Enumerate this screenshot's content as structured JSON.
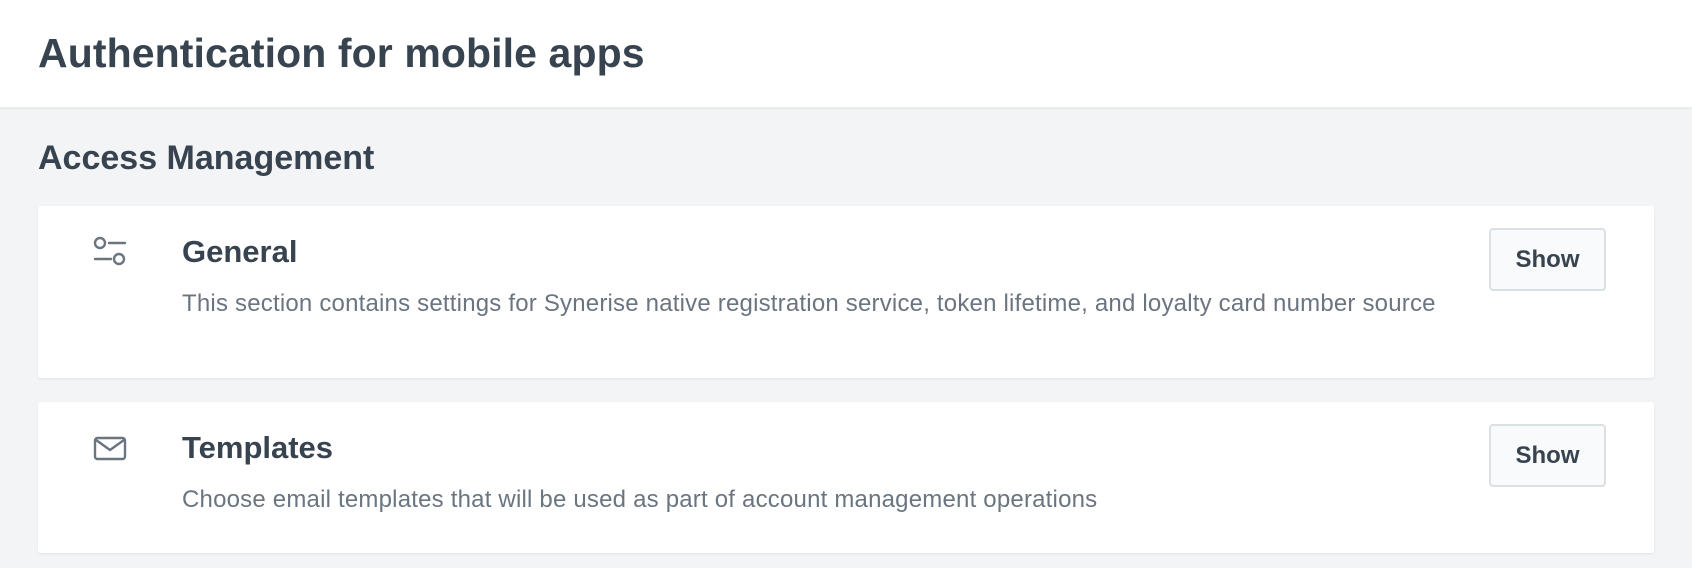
{
  "header": {
    "title": "Authentication for mobile apps"
  },
  "section": {
    "title": "Access Management"
  },
  "cards": [
    {
      "icon": "settings-sliders-icon",
      "title": "General",
      "description": "This section contains settings for Synerise native registration service, token lifetime, and loyalty card number source",
      "button_label": "Show"
    },
    {
      "icon": "mail-icon",
      "title": "Templates",
      "description": "Choose email templates that will be used as part of account management operations",
      "button_label": "Show"
    }
  ],
  "colors": {
    "background": "#f2f4f5",
    "card": "#ffffff",
    "title_text": "#384350",
    "secondary_text": "#6a7580",
    "icon": "#6a7580",
    "button_border": "#dbe0e3"
  }
}
